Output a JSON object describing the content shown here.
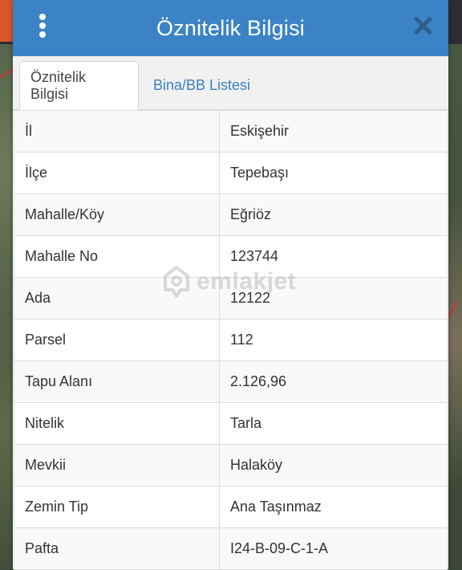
{
  "header": {
    "title": "Öznitelik Bilgisi",
    "menu_icon": "more-vertical-icon",
    "close_icon": "close-icon"
  },
  "tabs": [
    {
      "label": "Öznitelik Bilgisi",
      "active": true
    },
    {
      "label": "Bina/BB Listesi",
      "active": false
    }
  ],
  "attributes": [
    {
      "key": "İl",
      "value": "Eskişehir"
    },
    {
      "key": "İlçe",
      "value": "Tepebaşı"
    },
    {
      "key": "Mahalle/Köy",
      "value": "Eğriöz"
    },
    {
      "key": "Mahalle No",
      "value": "123744"
    },
    {
      "key": "Ada",
      "value": "12122"
    },
    {
      "key": "Parsel",
      "value": "112"
    },
    {
      "key": "Tapu Alanı",
      "value": "2.126,96"
    },
    {
      "key": "Nitelik",
      "value": "Tarla"
    },
    {
      "key": "Mevkii",
      "value": "Halaköy"
    },
    {
      "key": "Zemin Tip",
      "value": "Ana Taşınmaz"
    },
    {
      "key": "Pafta",
      "value": "I24-B-09-C-1-A"
    }
  ],
  "watermark": {
    "text": "emlakjet"
  },
  "colors": {
    "header": "#3b83c4",
    "tab_link": "#3a7fc0",
    "close": "#2d5e8e"
  }
}
